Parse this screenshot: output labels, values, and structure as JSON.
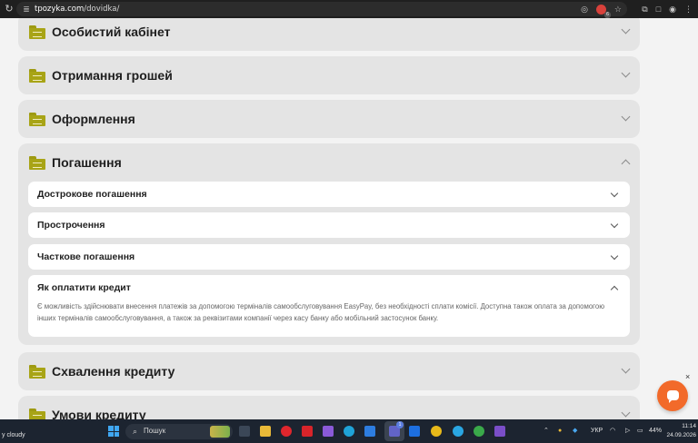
{
  "browser": {
    "url_host": "tpozyka.com",
    "url_path": "/dovidka/",
    "extension_badge": "6"
  },
  "faq": {
    "sections": [
      {
        "title": "Особистий кабінет"
      },
      {
        "title": "Отримання грошей"
      },
      {
        "title": "Оформлення"
      },
      {
        "title": "Погашення"
      },
      {
        "title": "Схвалення кредиту"
      },
      {
        "title": "Умови кредиту"
      }
    ],
    "repayment_items": [
      {
        "title": "Дострокове погашення"
      },
      {
        "title": "Прострочення"
      },
      {
        "title": "Часткове погашення"
      },
      {
        "title": "Як оплатити кредит"
      }
    ],
    "answer": "Є можливість здійснювати внесення платежів за допомогою терміналів самообслуговування EasyPay, без необхідності сплати комісії. Доступна також оплата за допомогою інших терміналів самообслуговування, а також за реквізитами компанії через касу банку або мобільний застосунок банку."
  },
  "chat": {
    "close": "×"
  },
  "taskbar": {
    "weather": "y cloudy",
    "search_placeholder": "Пошук",
    "teams_badge": "1",
    "language": "УКР",
    "battery": "44%",
    "time": "11:14",
    "date": "24.09.2026"
  },
  "icons": [
    "reload-icon",
    "site-settings-icon",
    "eye-off-icon",
    "star-icon",
    "extensions-icon",
    "split-icon",
    "profile-icon",
    "menu-icon",
    "folder-icon",
    "chevron-down-icon",
    "chevron-up-icon",
    "chat-icon",
    "windows-icon",
    "search-icon",
    "wifi-icon",
    "battery-icon"
  ]
}
